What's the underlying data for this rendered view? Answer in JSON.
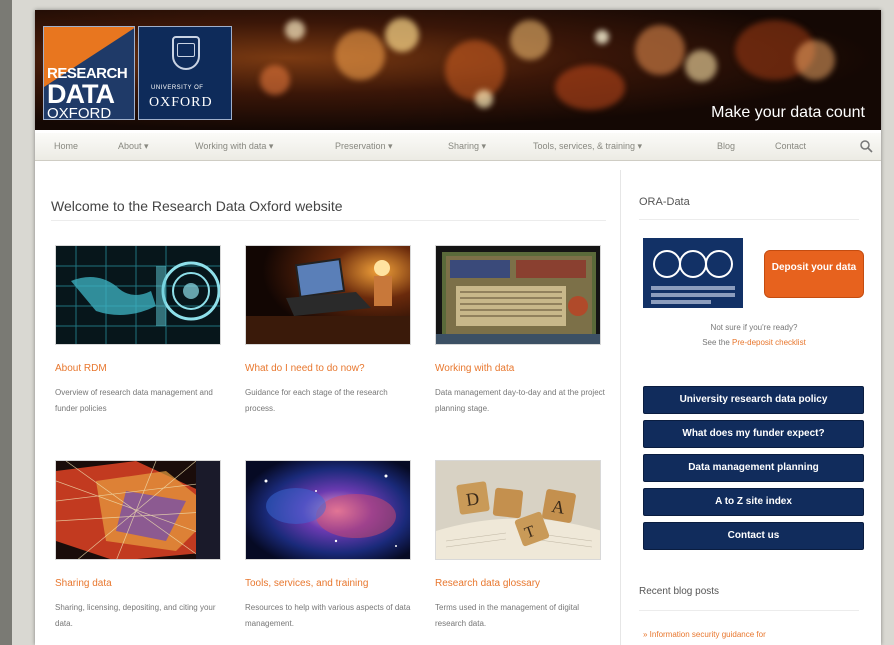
{
  "header": {
    "logo_rdo": {
      "line1": "RESEARCH",
      "line2": "DATA",
      "line3": "OXFORD"
    },
    "logo_oxford": {
      "small": "UNIVERSITY OF",
      "name": "OXFORD"
    },
    "tagline": "Make your data count"
  },
  "nav": {
    "items": [
      {
        "label": "Home"
      },
      {
        "label": "About ▾"
      },
      {
        "label": "Working with data ▾"
      },
      {
        "label": "Preservation ▾"
      },
      {
        "label": "Sharing ▾"
      },
      {
        "label": "Tools, services, & training ▾"
      },
      {
        "label": "Blog"
      },
      {
        "label": "Contact"
      }
    ]
  },
  "main": {
    "title": "Welcome to the Research Data Oxford website",
    "cards": [
      {
        "title": "About RDM",
        "desc": "Overview of research data management and funder policies"
      },
      {
        "title": "What do I need to do now?",
        "desc": "Guidance for each stage of the research process."
      },
      {
        "title": "Working with data",
        "desc": "Data management day-to-day and at the project planning stage."
      },
      {
        "title": "Sharing data",
        "desc": "Sharing, licensing, depositing, and citing your data."
      },
      {
        "title": "Tools, services, and training",
        "desc": "Resources to help with various aspects of data management."
      },
      {
        "title": "Research data glossary",
        "desc": "Terms used in the management of digital research data."
      }
    ]
  },
  "sidebar": {
    "title": "ORA-Data",
    "ora_logo_text": "ora",
    "deposit_label": "Deposit your data",
    "not_sure_line1": "Not sure if you're ready?",
    "not_sure_prefix": "See the ",
    "not_sure_link": "Pre-deposit checklist",
    "buttons": [
      {
        "label": "University research data policy"
      },
      {
        "label": "What does my funder expect?"
      },
      {
        "label": "Data management planning"
      },
      {
        "label": "A to Z site index"
      },
      {
        "label": "Contact us"
      }
    ],
    "blog_title": "Recent blog posts",
    "blog_items": [
      {
        "label": "» Information security guidance for"
      }
    ]
  },
  "colors": {
    "accent_orange": "#e8772e",
    "navy": "#112c5c",
    "deposit_orange": "#e7621e"
  }
}
